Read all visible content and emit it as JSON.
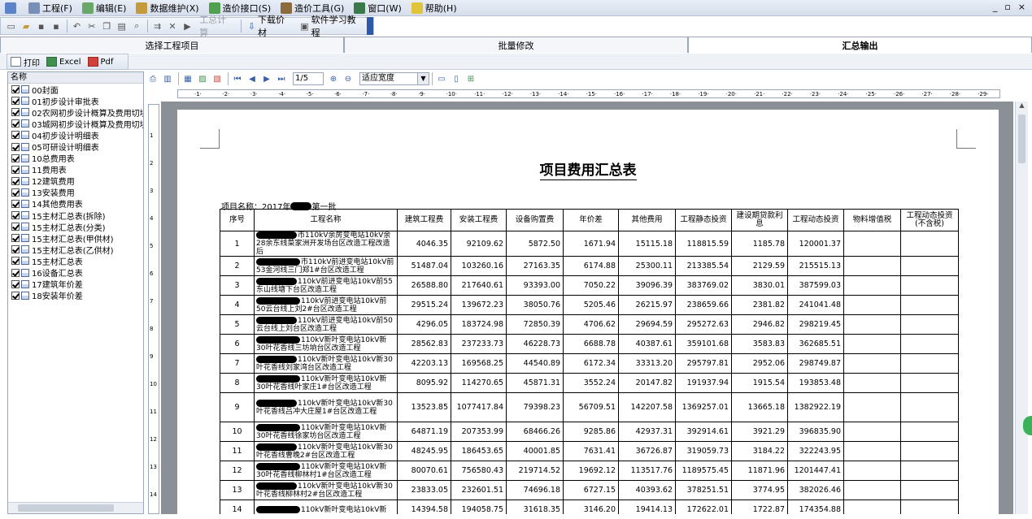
{
  "menubar": {
    "items": [
      {
        "label": "工程(F)",
        "icon": "project-icon"
      },
      {
        "label": "编辑(E)",
        "icon": "edit-icon"
      },
      {
        "label": "数据维护(X)",
        "icon": "data-maintain-icon"
      },
      {
        "label": "造价接口(S)",
        "icon": "cost-interface-icon"
      },
      {
        "label": "造价工具(G)",
        "icon": "cost-tools-icon"
      },
      {
        "label": "窗口(W)",
        "icon": "window-icon"
      },
      {
        "label": "帮助(H)",
        "icon": "help-icon"
      }
    ],
    "window_controls": [
      "_",
      "▫",
      "×"
    ]
  },
  "toolbar": {
    "calc_label": "工总计算",
    "download_label": "下载价材",
    "tutorial_label": "软件学习教程"
  },
  "tabs": [
    {
      "label": "选择工程项目",
      "active": false
    },
    {
      "label": "批量修改",
      "active": false
    },
    {
      "label": "汇总输出",
      "active": true
    }
  ],
  "printbar": {
    "print_label": "打印",
    "excel_label": "Excel",
    "pdf_label": "Pdf"
  },
  "report_tree": {
    "header": "名称",
    "items": [
      "00封面",
      "01初步设计审批表",
      "02农网初步设计概算及费用切块",
      "03城网初步设计概算及费用切块",
      "04初步设计明细表",
      "05可研设计明细表",
      "10总费用表",
      "11费用表",
      "12建筑费用",
      "13安装费用",
      "14其他费用表",
      "15主材汇总表(拆除)",
      "15主材汇总表(分类)",
      "15主材汇总表(甲供材)",
      "15主材汇总表(乙供材)",
      "15主材汇总表",
      "16设备汇总表",
      "17建筑年价差",
      "18安装年价差"
    ]
  },
  "viewer": {
    "page_indicator": "1/5",
    "zoom_mode": "适应宽度"
  },
  "document": {
    "title": "项目费用汇总表",
    "project_name_prefix": "项目名称：2017年",
    "project_name_suffix": "第一批",
    "columns": [
      "序号",
      "工程名称",
      "建筑工程费",
      "安装工程费",
      "设备购置费",
      "年价差",
      "其他费用",
      "工程静态投资",
      "建设期贷款利息",
      "工程动态投资",
      "物料增值税",
      "工程动态投资(不含税)"
    ],
    "rows": [
      {
        "no": "1",
        "name": "市110kV余房变电站10kV余28余东线菜家洲开发场台区改造工程改造后",
        "building": "4046.35",
        "install": "92109.62",
        "equipment": "5872.50",
        "price_diff": "1671.94",
        "other": "15115.18",
        "static": "118815.59",
        "interest": "1185.78",
        "dynamic": "120001.37"
      },
      {
        "no": "2",
        "name": "市110kV前进变电站10kV前53金河线三门郑1#台区改造工程",
        "building": "51487.04",
        "install": "103260.16",
        "equipment": "27163.35",
        "price_diff": "6174.88",
        "other": "25300.11",
        "static": "213385.54",
        "interest": "2129.59",
        "dynamic": "215515.13"
      },
      {
        "no": "3",
        "name": "110kV前进变电站10kV前55东山线塘下台区改造工程",
        "building": "26588.80",
        "install": "217640.61",
        "equipment": "93393.00",
        "price_diff": "7050.22",
        "other": "39096.39",
        "static": "383769.02",
        "interest": "3830.01",
        "dynamic": "387599.03"
      },
      {
        "no": "4",
        "name": "110kV前进变电站10kV前50云台线上刘2#台区改造工程",
        "building": "29515.24",
        "install": "139672.23",
        "equipment": "38050.76",
        "price_diff": "5205.46",
        "other": "26215.97",
        "static": "238659.66",
        "interest": "2381.82",
        "dynamic": "241041.48"
      },
      {
        "no": "5",
        "name": "110kV前进变电站10kV前50云台线上刘台区改造工程",
        "building": "4296.05",
        "install": "183724.98",
        "equipment": "72850.39",
        "price_diff": "4706.62",
        "other": "29694.59",
        "static": "295272.63",
        "interest": "2946.82",
        "dynamic": "298219.45"
      },
      {
        "no": "6",
        "name": "110kV新叶变电站10kV新30叶花香线三坊垧台区改造工程",
        "building": "28562.83",
        "install": "237233.73",
        "equipment": "46228.73",
        "price_diff": "6688.78",
        "other": "40387.61",
        "static": "359101.68",
        "interest": "3583.83",
        "dynamic": "362685.51"
      },
      {
        "no": "7",
        "name": "110kV新叶变电站10kV新30叶花香线刘家湾台区改造工程",
        "building": "42203.13",
        "install": "169568.25",
        "equipment": "44540.89",
        "price_diff": "6172.34",
        "other": "33313.20",
        "static": "295797.81",
        "interest": "2952.06",
        "dynamic": "298749.87"
      },
      {
        "no": "8",
        "name": "110kV新叶变电站10kV新30叶花香线叶家庄1#台区改造工程",
        "building": "8095.92",
        "install": "114270.65",
        "equipment": "45871.31",
        "price_diff": "3552.24",
        "other": "20147.82",
        "static": "191937.94",
        "interest": "1915.54",
        "dynamic": "193853.48"
      },
      {
        "no": "9",
        "name": "110kV新叶变电站10kV新30叶花香线吕冲大庄屋1#台区改造工程",
        "building": "13523.85",
        "install": "1077417.84",
        "equipment": "79398.23",
        "price_diff": "56709.51",
        "other": "142207.58",
        "static": "1369257.01",
        "interest": "13665.18",
        "dynamic": "1382922.19"
      },
      {
        "no": "10",
        "name": "110kV新叶变电站10kV新30叶花香线徐家坊台区改造工程",
        "building": "64871.19",
        "install": "207353.99",
        "equipment": "68466.26",
        "price_diff": "9285.86",
        "other": "42937.31",
        "static": "392914.61",
        "interest": "3921.29",
        "dynamic": "396835.90"
      },
      {
        "no": "11",
        "name": "110kV新叶变电站10kV新30叶花香线曹晚2#台区改造工程",
        "building": "48245.95",
        "install": "186453.65",
        "equipment": "40001.85",
        "price_diff": "7631.41",
        "other": "36726.87",
        "static": "319059.73",
        "interest": "3184.22",
        "dynamic": "322243.95"
      },
      {
        "no": "12",
        "name": "110kV新叶变电站10kV新30叶花香线柳林村1#台区改造工程",
        "building": "80070.61",
        "install": "756580.43",
        "equipment": "219714.52",
        "price_diff": "19692.12",
        "other": "113517.76",
        "static": "1189575.45",
        "interest": "11871.96",
        "dynamic": "1201447.41"
      },
      {
        "no": "13",
        "name": "110kV新叶变电站10kV新30叶花香线柳林村2#台区改造工程",
        "building": "23833.05",
        "install": "232601.51",
        "equipment": "74696.18",
        "price_diff": "6727.15",
        "other": "40393.62",
        "static": "378251.51",
        "interest": "3774.95",
        "dynamic": "382026.46"
      },
      {
        "no": "14",
        "name": "110kV新叶变电站10kV新",
        "building": "14394.58",
        "install": "194058.75",
        "equipment": "31618.35",
        "price_diff": "3146.20",
        "other": "19414.13",
        "static": "172622.01",
        "interest": "1722.87",
        "dynamic": "174354.88"
      }
    ]
  },
  "colors": {
    "accent_blue": "#2f58a6",
    "menubar_bg": "#d6deec",
    "doc_bg": "#8b8f96"
  }
}
